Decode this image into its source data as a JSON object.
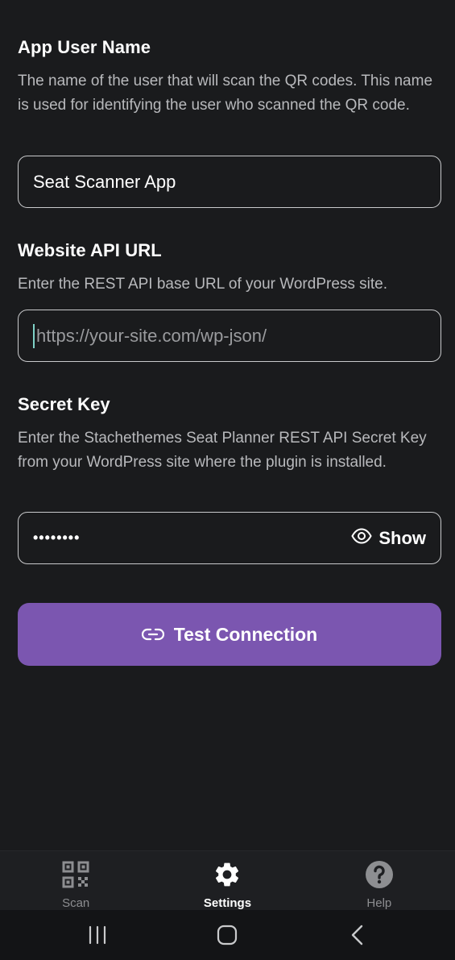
{
  "user_name": {
    "title": "App User Name",
    "description": "The name of the user that will scan the QR codes. This name is used for identifying the user who scanned the QR code.",
    "value": "Seat Scanner App"
  },
  "api_url": {
    "title": "Website API URL",
    "description": "Enter the REST API base URL of your WordPress site.",
    "value": "",
    "placeholder": "https://your-site.com/wp-json/"
  },
  "secret_key": {
    "title": "Secret Key",
    "description": "Enter the Stachethemes Seat Planner REST API Secret Key from your WordPress site where the plugin is installed.",
    "masked_value": "••••••••",
    "show_label": "Show",
    "show_icon": "eye-icon"
  },
  "test_button": {
    "label": "Test Connection",
    "icon": "link-icon",
    "color": "#7b56b0"
  },
  "tabs": [
    {
      "label": "Scan",
      "icon": "qr-code-icon",
      "active": false
    },
    {
      "label": "Settings",
      "icon": "gear-icon",
      "active": true
    },
    {
      "label": "Help",
      "icon": "help-icon",
      "active": false
    }
  ],
  "colors": {
    "background": "#1a1b1d",
    "accent": "#7b56b0",
    "muted_text": "#b8b9bc"
  }
}
